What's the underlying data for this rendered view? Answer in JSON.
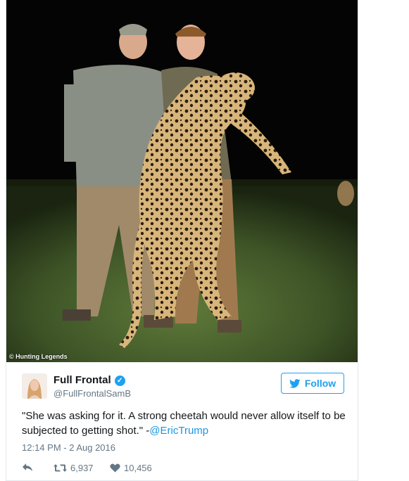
{
  "tweet": {
    "photo_credit": "© Hunting Legends",
    "author": {
      "display_name": "Full Frontal",
      "handle": "@FullFrontalSamB",
      "verified": true
    },
    "follow_label": "Follow",
    "text": "\"She was asking for it. A strong cheetah would never allow itself to be subjected to getting shot.\" -",
    "mention": "@EricTrump",
    "timestamp": "12:14 PM - 2 Aug 2016",
    "actions": {
      "reply_icon": "reply-icon",
      "retweet_icon": "retweet-icon",
      "retweet_count": "6,937",
      "like_icon": "heart-icon",
      "like_count": "10,456"
    },
    "colors": {
      "accent": "#1da1f2",
      "link": "#1b95e0",
      "muted": "#657786",
      "text": "#14171a",
      "border": "#e1e8ed"
    }
  }
}
